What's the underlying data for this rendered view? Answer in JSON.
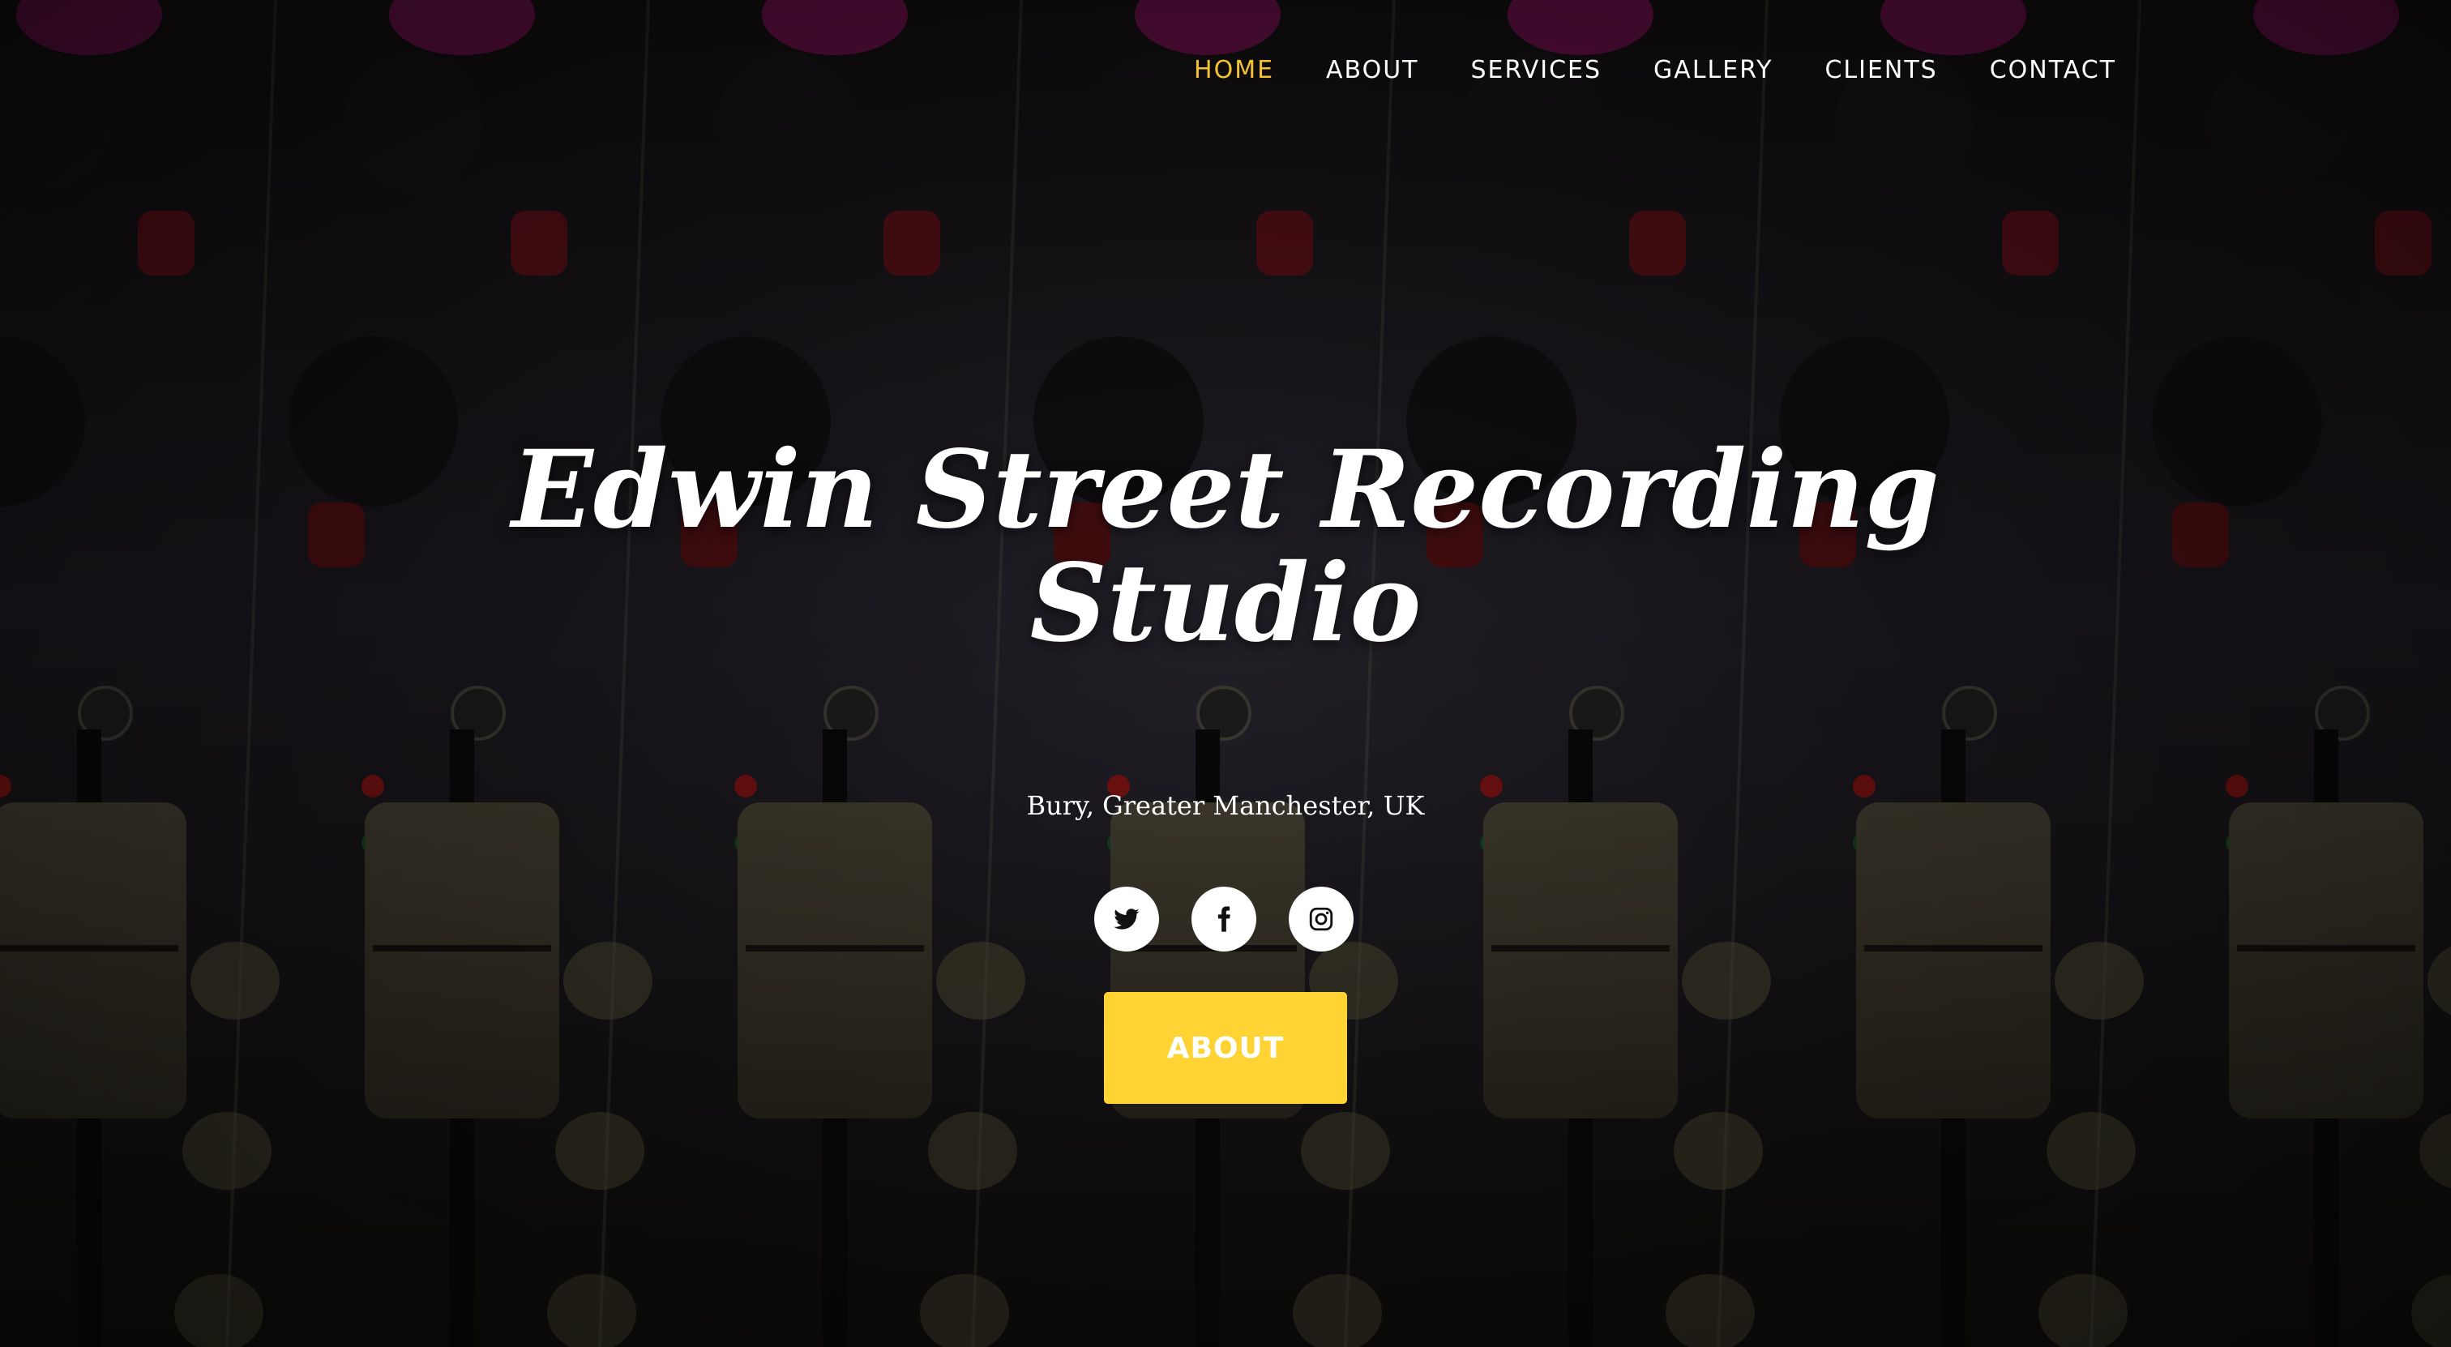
{
  "nav": {
    "items": [
      {
        "label": "HOME",
        "active": true
      },
      {
        "label": "ABOUT",
        "active": false
      },
      {
        "label": "SERVICES",
        "active": false
      },
      {
        "label": "GALLERY",
        "active": false
      },
      {
        "label": "CLIENTS",
        "active": false
      },
      {
        "label": "CONTACT",
        "active": false
      }
    ],
    "active_color": "#f2c230"
  },
  "hero": {
    "title": "Edwin Street Recording Studio",
    "subtitle": "Bury, Greater Manchester, UK",
    "cta_label": "ABOUT",
    "cta_color": "#ffd334",
    "background_icon": "mixing-desk-photo"
  },
  "social": [
    {
      "icon": "twitter-icon"
    },
    {
      "icon": "facebook-icon"
    },
    {
      "icon": "instagram-icon"
    }
  ]
}
